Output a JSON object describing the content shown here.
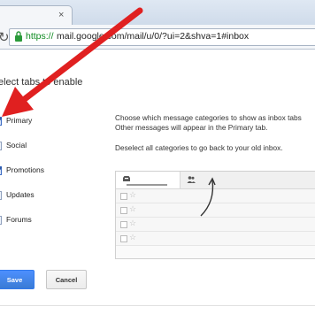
{
  "browser": {
    "url_scheme": "https://",
    "url_rest": "mail.google.com/mail/u/0/?ui=2&shva=1#inbox",
    "tab_close_glyph": "×"
  },
  "page": {
    "subtitle": "elect tabs to enable"
  },
  "categories": [
    {
      "label": "Primary",
      "checked": true
    },
    {
      "label": "Social",
      "checked": false
    },
    {
      "label": "Promotions",
      "checked": true
    },
    {
      "label": "Updates",
      "checked": false
    },
    {
      "label": "Forums",
      "checked": false
    }
  ],
  "description": {
    "line1": "Choose which message categories to show as inbox tabs",
    "line2": "Other messages will appear in the Primary tab.",
    "line3": "Deselect all categories to go back to your old inbox."
  },
  "preview": {
    "tabs": [
      {
        "icon": "inbox-icon",
        "selected": true
      },
      {
        "icon": "social-icon",
        "selected": false
      }
    ],
    "rows": 4,
    "star_glyph": "☆"
  },
  "buttons": {
    "save_label": "Save",
    "cancel_label": "Cancel"
  },
  "colors": {
    "accent": "#4d90fe",
    "annotation_arrow": "#e02020",
    "url_secure": "#0d8a1f"
  }
}
